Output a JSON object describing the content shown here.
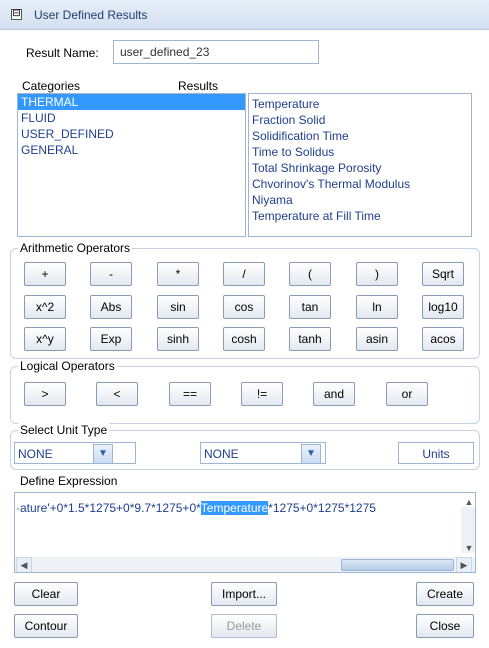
{
  "header": {
    "title": "User Defined Results",
    "collapse_icon": "⊟"
  },
  "result_name": {
    "label": "Result Name:",
    "value": "user_defined_23"
  },
  "categories": {
    "header": "Categories",
    "items": [
      "THERMAL",
      "FLUID",
      "USER_DEFINED",
      "GENERAL"
    ],
    "selected": "THERMAL"
  },
  "results": {
    "header": "Results",
    "items": [
      "Temperature",
      "Fraction Solid",
      "Solidification Time",
      "Time to Solidus",
      "Total Shrinkage Porosity",
      "Chvorinov's Thermal Modulus",
      "Niyama",
      "Temperature at Fill Time"
    ]
  },
  "arithmetic": {
    "title": "Arithmetic Operators",
    "rows": [
      [
        "+",
        "-",
        "*",
        "/",
        "(",
        ")",
        "Sqrt"
      ],
      [
        "x^2",
        "Abs",
        "sin",
        "cos",
        "tan",
        "ln",
        "log10"
      ],
      [
        "x^y",
        "Exp",
        "sinh",
        "cosh",
        "tanh",
        "asin",
        "acos"
      ]
    ]
  },
  "logical": {
    "title": "Logical Operators",
    "buttons": [
      ">",
      "<",
      "==",
      "!=",
      "and",
      "or"
    ]
  },
  "unit_type": {
    "title": "Select Unit Type",
    "select1": "NONE",
    "select2": "NONE",
    "units_label": "Units"
  },
  "expression": {
    "title": "Define Expression",
    "before": "·ature'+0*1.5*1275+0*9.7*1275+0*",
    "selected": "Temperature",
    "after": "*1275+0*1275*1275"
  },
  "actions": {
    "clear": "Clear",
    "import": "Import...",
    "create": "Create",
    "contour": "Contour",
    "delete": "Delete",
    "close": "Close"
  },
  "colors": {
    "selection": "#3399ff",
    "list_text": "#1f3f8e",
    "header_bg": "#d3e0ef"
  }
}
